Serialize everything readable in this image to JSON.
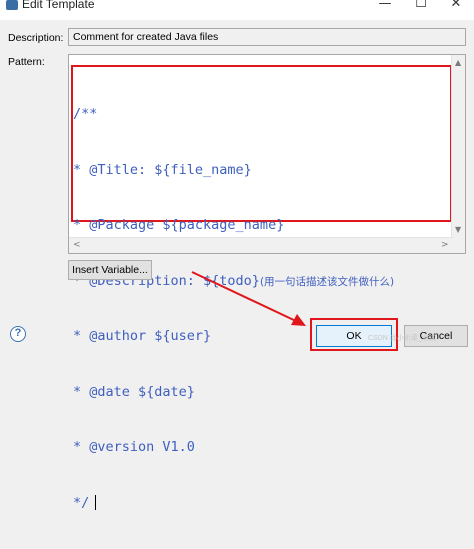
{
  "window": {
    "title": "Edit Template",
    "minimize_glyph": "—",
    "maximize_glyph": "☐",
    "close_glyph": "✕",
    "icon": "template-icon"
  },
  "form": {
    "description_label": "Description:",
    "description_value": "Comment for created Java files",
    "pattern_label": "Pattern:"
  },
  "pattern": {
    "lines": [
      "/**",
      "* @Title: ${file_name}",
      "* @Package ${package_name}",
      "* @Description: ${todo}",
      "* @author ${user}",
      "* @date ${date}",
      "* @version V1.0",
      "*/"
    ],
    "description_note": "(用一句话描述该文件做什么)"
  },
  "buttons": {
    "insert_variable": "Insert Variable...",
    "ok": "OK",
    "cancel": "Cancel",
    "help": "?"
  },
  "scrollbar_arrows": {
    "up": "▲",
    "down": "▼",
    "left": "<",
    "right": ">"
  },
  "watermark": "CSDN @小趴菜_测试",
  "colors": {
    "highlight": "#e0161b",
    "code_text": "#3f5fbf"
  }
}
